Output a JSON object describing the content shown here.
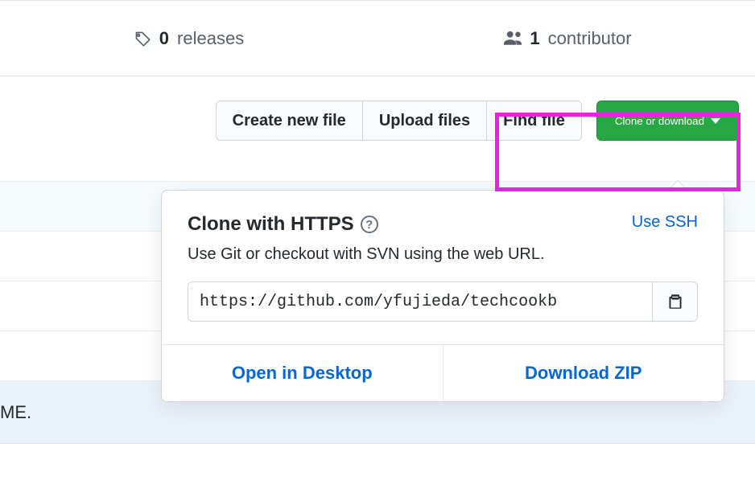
{
  "stats": {
    "releases": {
      "count": "0",
      "label": "releases"
    },
    "contributors": {
      "count": "1",
      "label": "contributor"
    }
  },
  "toolbar": {
    "create_file": "Create new file",
    "upload_files": "Upload files",
    "find_file": "Find file",
    "clone_download": "Clone or download"
  },
  "clone_panel": {
    "title": "Clone with HTTPS",
    "use_ssh": "Use SSH",
    "description": "Use Git or checkout with SVN using the web URL.",
    "url": "https://github.com/yfujieda/techcookb",
    "open_desktop": "Open in Desktop",
    "download_zip": "Download ZIP"
  },
  "bg_row_text": "ME."
}
